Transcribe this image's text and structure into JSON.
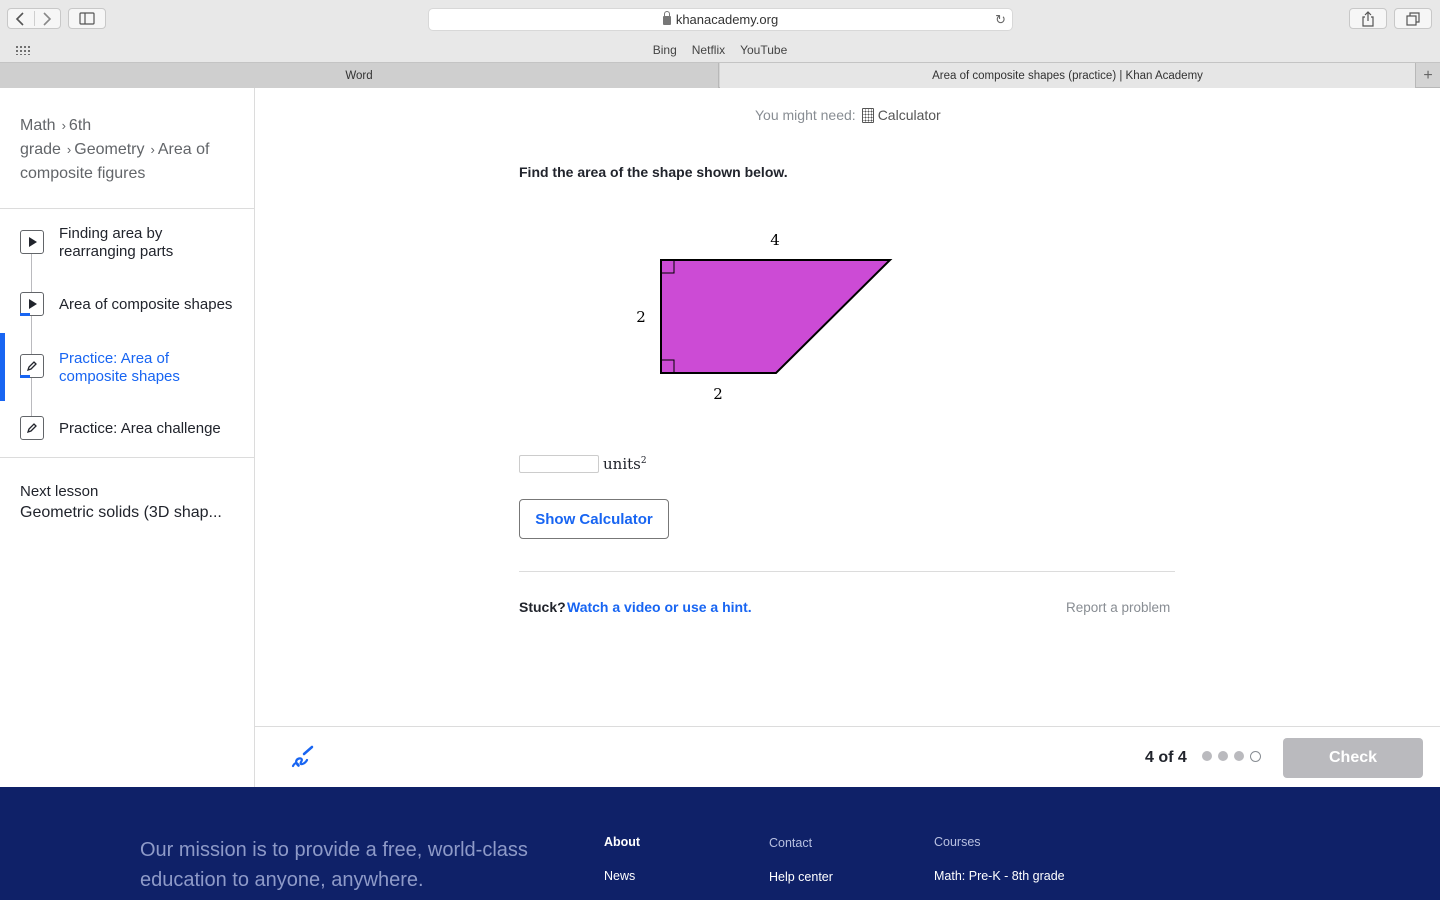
{
  "browser": {
    "url": "khanacademy.org",
    "favorites": [
      "Bing",
      "Netflix",
      "YouTube"
    ],
    "tabs": [
      {
        "title": "Word"
      },
      {
        "title": "Area of composite shapes (practice) | Khan Academy"
      }
    ]
  },
  "breadcrumb": {
    "items": [
      "Math",
      "6th grade",
      "Geometry",
      "Area of composite figures"
    ]
  },
  "lessons": [
    {
      "label": "Finding area by rearranging parts",
      "icon": "play-icon"
    },
    {
      "label": "Area of composite shapes",
      "icon": "play-icon"
    },
    {
      "label": "Practice: Area of composite shapes",
      "icon": "pencil-icon",
      "active": true
    },
    {
      "label": "Practice: Area challenge",
      "icon": "pencil-icon"
    }
  ],
  "next_lesson": {
    "label": "Next lesson",
    "title": "Geometric solids (3D shap..."
  },
  "exercise": {
    "might_need_label": "You might need:",
    "calculator_label": "Calculator",
    "question": "Find the area of the shape shown below.",
    "figure": {
      "top_label": "4",
      "left_label": "2",
      "bottom_label": "2",
      "fill_color": "#cc4bd5"
    },
    "answer_value": "",
    "units_label": "units",
    "units_exponent": "2",
    "show_calculator_label": "Show Calculator",
    "stuck_label": "Stuck?",
    "hint_link_label": "Watch a video or use a hint.",
    "report_label": "Report a problem"
  },
  "action_bar": {
    "progress": "4 of 4",
    "current_question": 4,
    "total_questions": 4,
    "check_label": "Check"
  },
  "footer": {
    "mission": "Our mission is to provide a free, world-class education to anyone, anywhere.",
    "about": {
      "heading": "About",
      "link": "News"
    },
    "contact": {
      "heading": "Contact",
      "link": "Help center"
    },
    "courses": {
      "heading": "Courses",
      "link": "Math: Pre-K - 8th grade"
    }
  },
  "colors": {
    "accent": "#1865f2",
    "footer_bg": "#0f2168",
    "shape_fill": "#cc4bd5"
  }
}
